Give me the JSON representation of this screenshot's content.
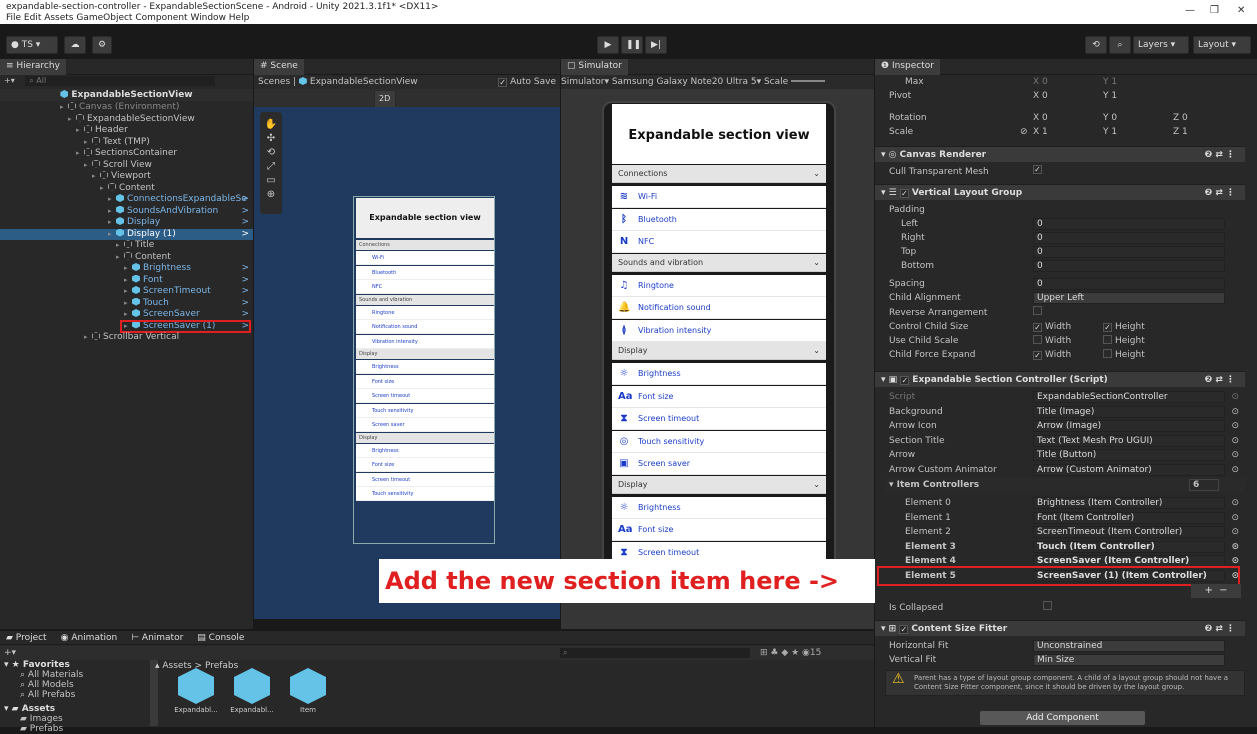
{
  "window": {
    "title": "expandable-section-controller - ExpandableSectionScene - Android - Unity 2021.3.1f1* <DX11>",
    "menu": "File  Edit  Assets  GameObject  Component  Window  Help"
  },
  "toolbar": {
    "account": "TS",
    "layers": "Layers",
    "layout": "Layout"
  },
  "hierarchy": {
    "tab": "Hierarchy",
    "search_placeholder": "All",
    "scene": "ExpandableSectionView",
    "items": [
      {
        "label": "Canvas (Environment)",
        "indent": 0,
        "icon": "go",
        "dim": true
      },
      {
        "label": "ExpandableSectionView",
        "indent": 1,
        "icon": "go"
      },
      {
        "label": "Header",
        "indent": 2,
        "icon": "go"
      },
      {
        "label": "Text (TMP)",
        "indent": 3,
        "icon": "go"
      },
      {
        "label": "SectionsContainer",
        "indent": 2,
        "icon": "go"
      },
      {
        "label": "Scroll View",
        "indent": 3,
        "icon": "go"
      },
      {
        "label": "Viewport",
        "indent": 4,
        "icon": "go"
      },
      {
        "label": "Content",
        "indent": 5,
        "icon": "go"
      },
      {
        "label": "ConnectionsExpandableSe",
        "indent": 6,
        "icon": "cube",
        "blue": true
      },
      {
        "label": "SoundsAndVibration",
        "indent": 6,
        "icon": "cube",
        "blue": true
      },
      {
        "label": "Display",
        "indent": 6,
        "icon": "cube",
        "blue": true
      },
      {
        "label": "Display (1)",
        "indent": 6,
        "icon": "cube",
        "selected": true
      },
      {
        "label": "Title",
        "indent": 7,
        "icon": "go"
      },
      {
        "label": "Content",
        "indent": 7,
        "icon": "go"
      },
      {
        "label": "Brightness",
        "indent": 8,
        "icon": "cube",
        "blue": true
      },
      {
        "label": "Font",
        "indent": 8,
        "icon": "cube",
        "blue": true
      },
      {
        "label": "ScreenTimeout",
        "indent": 8,
        "icon": "cube",
        "blue": true
      },
      {
        "label": "Touch",
        "indent": 8,
        "icon": "cube",
        "blue": true
      },
      {
        "label": "ScreenSaver",
        "indent": 8,
        "icon": "cube",
        "blue": true
      },
      {
        "label": "ScreenSaver (1)",
        "indent": 8,
        "icon": "cube",
        "blue": true,
        "boxed": true
      },
      {
        "label": "Scrollbar Vertical",
        "indent": 3,
        "icon": "go"
      }
    ]
  },
  "scene": {
    "tab": "Scene",
    "breadcrumb_root": "Scenes",
    "breadcrumb_leaf": "ExpandableSectionView",
    "auto_save": "Auto Save",
    "mode_2d": "2D"
  },
  "simulator": {
    "tab": "Simulator",
    "mode": "Simulator",
    "device": "Samsung Galaxy Note20 Ultra 5",
    "scale": "Scale"
  },
  "phone": {
    "header": "Expandable section view",
    "sections": [
      {
        "title": "Connections",
        "items": [
          {
            "icon": "wifi",
            "label": "Wi-Fi"
          },
          {
            "icon": "bluetooth",
            "label": "Bluetooth"
          },
          {
            "icon": "nfc",
            "label": "NFC"
          }
        ]
      },
      {
        "title": "Sounds and vibration",
        "items": [
          {
            "icon": "ringtone",
            "label": "Ringtone"
          },
          {
            "icon": "notification",
            "label": "Notification sound"
          },
          {
            "icon": "vibration",
            "label": "Vibration intensity"
          }
        ]
      },
      {
        "title": "Display",
        "items": [
          {
            "icon": "brightness",
            "label": "Brightness"
          },
          {
            "icon": "font",
            "label": "Font size"
          },
          {
            "icon": "timeout",
            "label": "Screen timeout"
          },
          {
            "icon": "touch",
            "label": "Touch sensitivity"
          },
          {
            "icon": "screensaver",
            "label": "Screen saver"
          }
        ]
      },
      {
        "title": "Display",
        "items": [
          {
            "icon": "brightness",
            "label": "Brightness"
          },
          {
            "icon": "font",
            "label": "Font size"
          },
          {
            "icon": "timeout",
            "label": "Screen timeout"
          }
        ]
      }
    ]
  },
  "scene_preview": {
    "header": "Expandable section view",
    "sections": [
      {
        "title": "Connections",
        "items": [
          "Wi-Fi",
          "Bluetooth",
          "NFC"
        ]
      },
      {
        "title": "Sounds and vibration",
        "items": [
          "Ringtone",
          "Notification sound",
          "Vibration intensity"
        ]
      },
      {
        "title": "Display",
        "items": [
          "Brightness",
          "Font size",
          "Screen timeout",
          "Touch sensitivity",
          "Screen saver"
        ]
      },
      {
        "title": "Display",
        "items": [
          "Brightness",
          "Font size",
          "Screen timeout",
          "Touch sensitivity"
        ]
      }
    ]
  },
  "annotation": "Add the new section item here ->",
  "inspector": {
    "tab": "Inspector",
    "max": {
      "label": "Max",
      "x": "0",
      "y": "1"
    },
    "pivot": {
      "label": "Pivot",
      "x": "0",
      "y": "1"
    },
    "rotation": {
      "label": "Rotation",
      "x": "0",
      "y": "0",
      "z": "0"
    },
    "scale": {
      "label": "Scale",
      "x": "1",
      "y": "1",
      "z": "1"
    },
    "canvas_renderer": {
      "title": "Canvas Renderer",
      "cull_label": "Cull Transparent Mesh"
    },
    "vlg": {
      "title": "Vertical Layout Group",
      "padding": "Padding",
      "left": "Left",
      "right": "Right",
      "top": "Top",
      "bottom": "Bottom",
      "left_v": "0",
      "right_v": "0",
      "top_v": "0",
      "bottom_v": "0",
      "spacing": "Spacing",
      "spacing_v": "0",
      "child_alignment": "Child Alignment",
      "child_alignment_v": "Upper Left",
      "reverse": "Reverse Arrangement",
      "control_size": "Control Child Size",
      "use_scale": "Use Child Scale",
      "force_expand": "Child Force Expand",
      "width": "Width",
      "height": "Height"
    },
    "esc": {
      "title": "Expandable Section Controller (Script)",
      "fields": [
        {
          "label": "Script",
          "value": "ExpandableSectionController"
        },
        {
          "label": "Background",
          "value": "Title (Image)"
        },
        {
          "label": "Arrow Icon",
          "value": "Arrow (Image)"
        },
        {
          "label": "Section Title",
          "value": "Text (Text Mesh Pro UGUI)"
        },
        {
          "label": "Arrow",
          "value": "Title (Button)"
        },
        {
          "label": "Arrow Custom Animator",
          "value": "Arrow (Custom Animator)"
        }
      ],
      "item_controllers": "Item Controllers",
      "count": "6",
      "elements": [
        {
          "label": "Element 0",
          "value": "Brightness (Item Controller)"
        },
        {
          "label": "Element 1",
          "value": "Font (Item Controller)"
        },
        {
          "label": "Element 2",
          "value": "ScreenTimeout (Item Controller)"
        },
        {
          "label": "Element 3",
          "value": "Touch (Item Controller)"
        },
        {
          "label": "Element 4",
          "value": "ScreenSaver (Item Controller)"
        },
        {
          "label": "Element 5",
          "value": "ScreenSaver (1) (Item Controller)"
        }
      ],
      "is_collapsed": "Is Collapsed"
    },
    "csf": {
      "title": "Content Size Fitter",
      "h_fit": "Horizontal Fit",
      "h_fit_v": "Unconstrained",
      "v_fit": "Vertical Fit",
      "v_fit_v": "Min Size",
      "warning": "Parent has a type of layout group component. A child of a layout group should not have a Content Size Fitter component, since it should be driven by the layout group."
    },
    "add_component": "Add Component"
  },
  "project": {
    "tabs": [
      "Project",
      "Animation",
      "Animator",
      "Console"
    ],
    "favorites": "Favorites",
    "fav_items": [
      "All Materials",
      "All Models",
      "All Prefabs"
    ],
    "assets": "Assets",
    "asset_folders": [
      "Images",
      "Prefabs"
    ],
    "breadcrumb": "Assets > Prefabs",
    "prefabs": [
      "Expandabl...",
      "Expandabl...",
      "Item"
    ],
    "count": "15"
  }
}
